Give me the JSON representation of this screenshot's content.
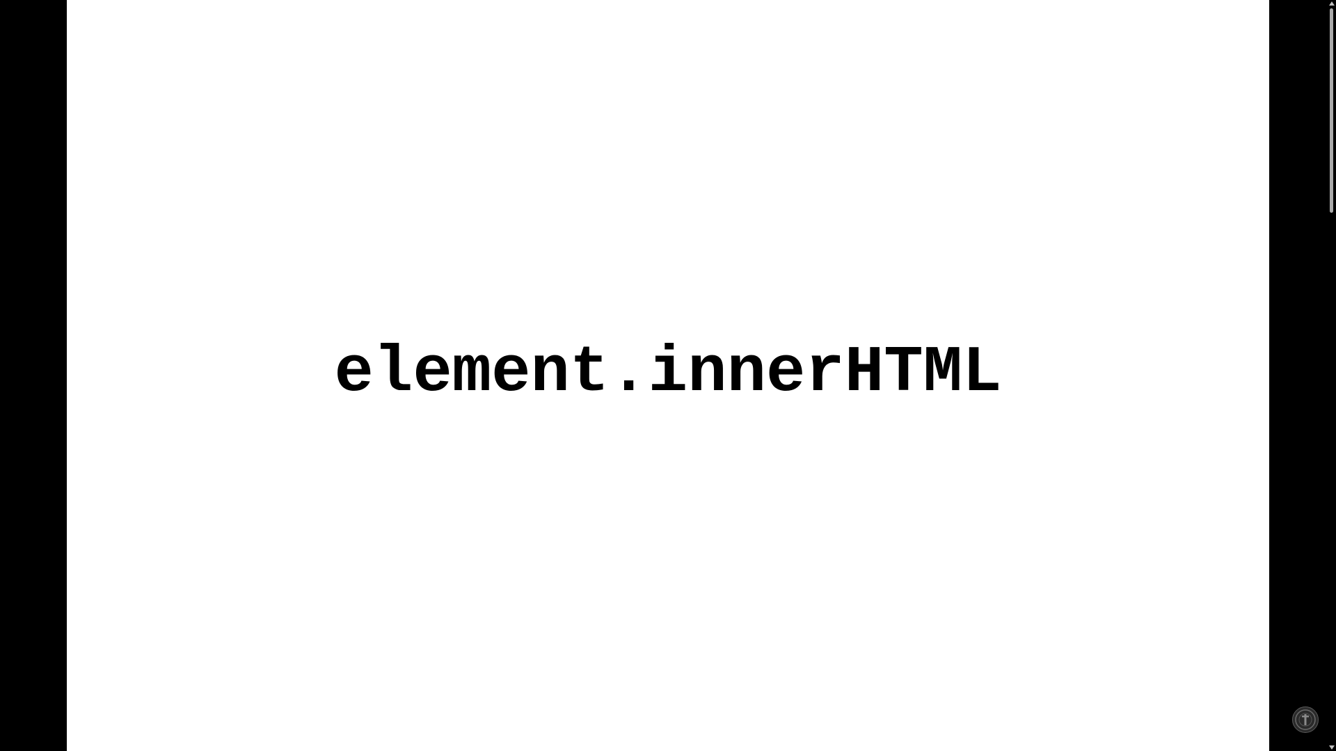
{
  "slide": {
    "title": "element.innerHTML"
  },
  "overlay": {
    "logo_icon": "channel-logo-icon"
  },
  "colors": {
    "background": "#000000",
    "slide": "#ffffff",
    "text": "#000000",
    "scrollbar_thumb": "#a9a9a9"
  }
}
